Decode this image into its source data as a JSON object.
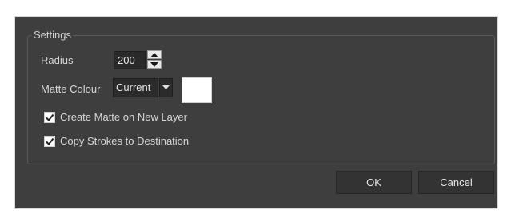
{
  "settings": {
    "group_title": "Settings",
    "radius_label": "Radius",
    "radius_value": "200",
    "matte_colour_label": "Matte Colour",
    "matte_colour_selected": "Current",
    "matte_colour_swatch": "#ffffff",
    "create_matte_label": "Create Matte on New Layer",
    "create_matte_checked": true,
    "copy_strokes_label": "Copy Strokes to Destination",
    "copy_strokes_checked": true
  },
  "buttons": {
    "ok_label": "OK",
    "cancel_label": "Cancel"
  },
  "icons": {
    "spin_up": "triangle-up-icon",
    "spin_down": "triangle-down-icon",
    "dropdown": "chevron-down-icon",
    "checkbox": "checkmark-icon"
  },
  "colors": {
    "dialog_bg": "#3e3e3e",
    "text": "#d6d6d6",
    "button_bg": "#333333"
  }
}
